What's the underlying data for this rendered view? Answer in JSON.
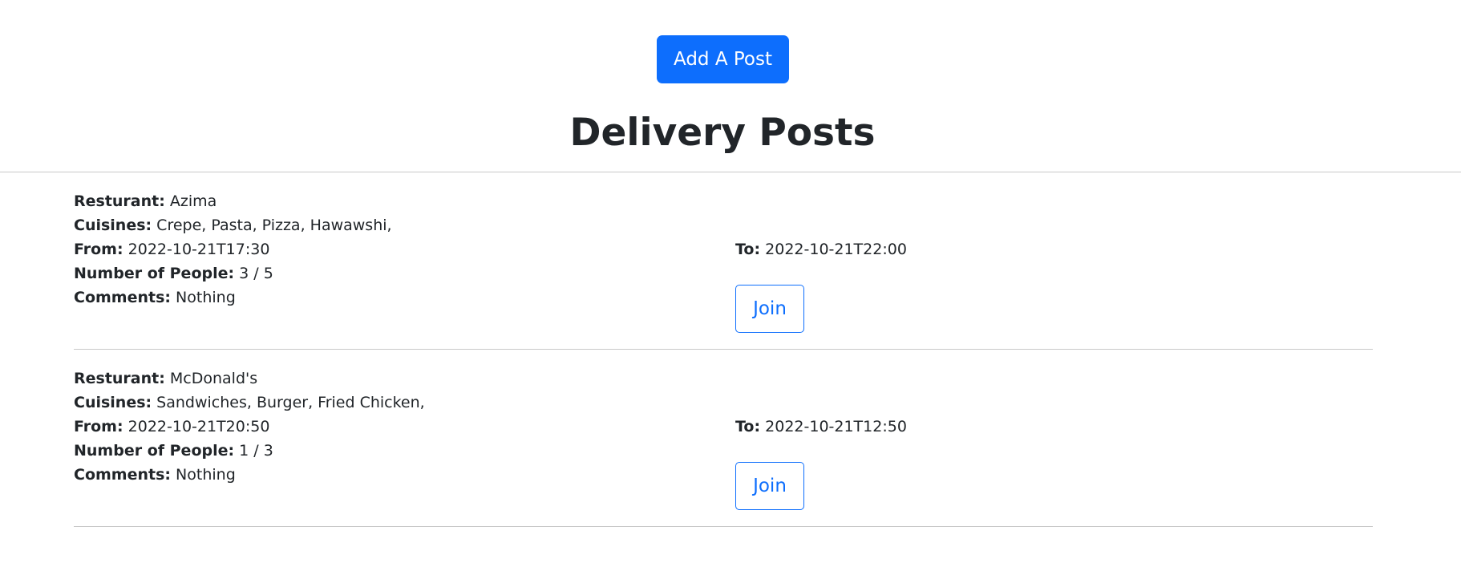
{
  "header": {
    "add_post_label": "Add A Post",
    "title": "Delivery Posts"
  },
  "labels": {
    "restaurant": "Resturant:",
    "cuisines": "Cuisines:",
    "from": "From:",
    "people": "Number of People:",
    "comments": "Comments:",
    "to": "To:",
    "join": "Join"
  },
  "posts": [
    {
      "restaurant": "Azima",
      "cuisines": "Crepe, Pasta, Pizza, Hawawshi,",
      "from": "2022-10-21T17:30",
      "people": "3 / 5",
      "comments": "Nothing",
      "to": "2022-10-21T22:00"
    },
    {
      "restaurant": "McDonald's",
      "cuisines": "Sandwiches, Burger, Fried Chicken,",
      "from": "2022-10-21T20:50",
      "people": "1 / 3",
      "comments": "Nothing",
      "to": "2022-10-21T12:50"
    }
  ],
  "colors": {
    "primary": "#0d6efd",
    "text": "#212529",
    "divider": "#c8c8c8"
  }
}
